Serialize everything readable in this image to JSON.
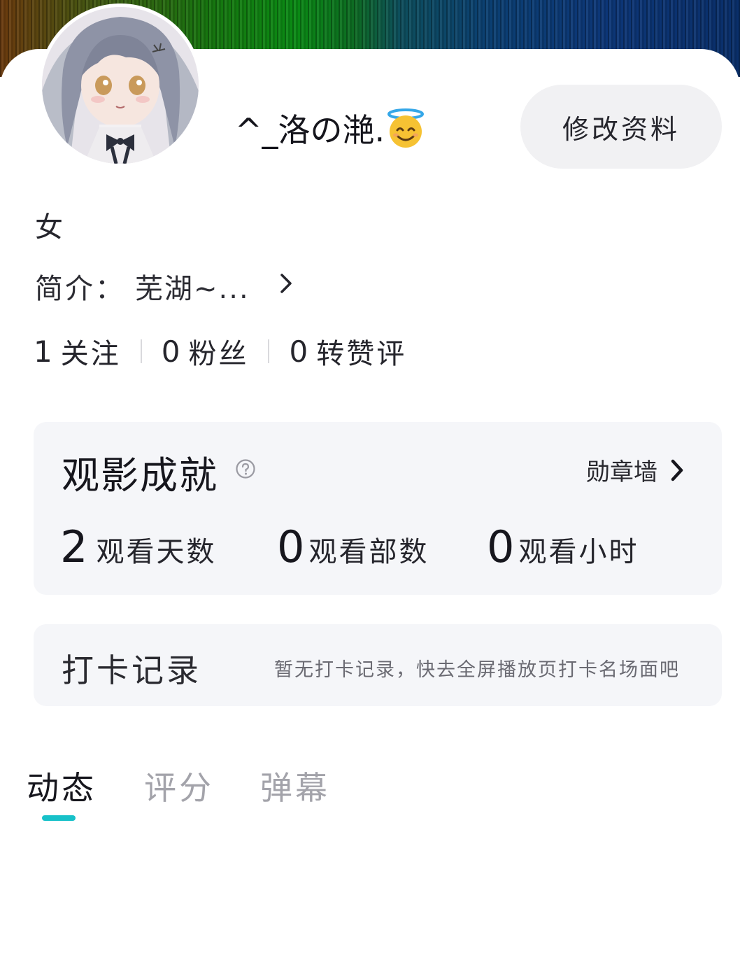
{
  "profile": {
    "nickname": "^_洛の滟.",
    "nickname_emoji": "smiling-face-with-halo",
    "edit_label": "修改资料",
    "gender": "女",
    "bio_prefix": "简介：",
    "bio_text": "芜湖~..."
  },
  "stats": [
    {
      "value": "1",
      "label": "关注"
    },
    {
      "value": "0",
      "label": "粉丝"
    },
    {
      "value": "0",
      "label": "转赞评"
    }
  ],
  "achievements": {
    "title": "观影成就",
    "wall_label": "勋章墙",
    "metrics": [
      {
        "value": "2",
        "label": "观看天数"
      },
      {
        "value": "0",
        "label": "观看部数"
      },
      {
        "value": "0",
        "label": "观看小时"
      }
    ]
  },
  "checkin": {
    "title": "打卡记录",
    "empty_hint": "暂无打卡记录，快去全屏播放页打卡名场面吧"
  },
  "tabs": [
    {
      "label": "动态",
      "active": true
    },
    {
      "label": "评分",
      "active": false
    },
    {
      "label": "弹幕",
      "active": false
    }
  ],
  "colors": {
    "accent": "#17c1c9",
    "card_bg": "#f5f6f9",
    "button_bg": "#f1f1f3"
  }
}
